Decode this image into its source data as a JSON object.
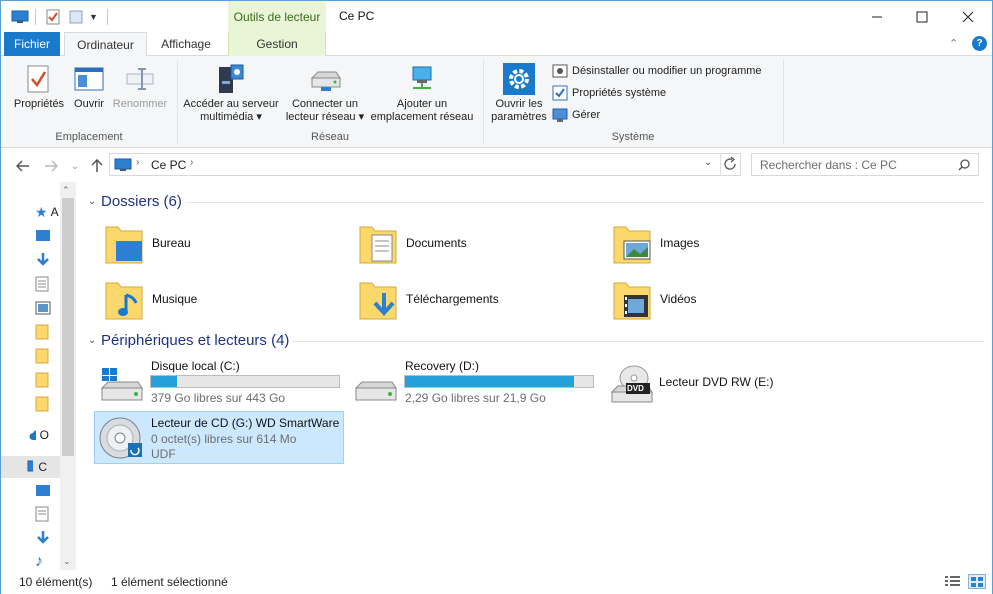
{
  "window": {
    "title": "Ce PC",
    "context_tab_header": "Outils de lecteur",
    "minimize": "—",
    "maximize": "☐",
    "close": "✕"
  },
  "tabs": {
    "file": "Fichier",
    "computer": "Ordinateur",
    "view": "Affichage",
    "manage": "Gestion"
  },
  "ribbon": {
    "location": {
      "label": "Emplacement",
      "properties": "Propriétés",
      "open": "Ouvrir",
      "rename": "Renommer"
    },
    "network": {
      "label": "Réseau",
      "media_l1": "Accéder au serveur",
      "media_l2": "multimédia",
      "map_l1": "Connecter un",
      "map_l2": "lecteur réseau",
      "add_l1": "Ajouter un",
      "add_l2": "emplacement réseau"
    },
    "system": {
      "label": "Système",
      "settings_l1": "Ouvrir les",
      "settings_l2": "paramètres",
      "uninstall": "Désinstaller ou modifier un programme",
      "sysprops": "Propriétés système",
      "manage": "Gérer"
    }
  },
  "address": {
    "location": "Ce PC",
    "search_placeholder": "Rechercher dans : Ce PC"
  },
  "sidebar": {
    "quick_access_partial": "A",
    "onedrive_partial": "O",
    "thispc_partial": "C"
  },
  "folders": {
    "header": "Dossiers (6)",
    "items": [
      {
        "name": "Bureau",
        "icon": "desktop-folder-icon"
      },
      {
        "name": "Documents",
        "icon": "documents-folder-icon"
      },
      {
        "name": "Images",
        "icon": "pictures-folder-icon"
      },
      {
        "name": "Musique",
        "icon": "music-folder-icon"
      },
      {
        "name": "Téléchargements",
        "icon": "downloads-folder-icon"
      },
      {
        "name": "Vidéos",
        "icon": "videos-folder-icon"
      }
    ]
  },
  "devices": {
    "header": "Périphériques et lecteurs (4)",
    "items": [
      {
        "name": "Disque local (C:)",
        "free": "379 Go libres sur 443 Go",
        "used_fraction": 0.14
      },
      {
        "name": "Recovery (D:)",
        "free": "2,29 Go libres sur 21,9 Go",
        "used_fraction": 0.9
      },
      {
        "name": "Lecteur DVD RW (E:)",
        "badge": "DVD"
      },
      {
        "name": "Lecteur de CD (G:) WD SmartWare",
        "free": "0 octet(s) libres sur 614 Mo",
        "fs": "UDF"
      }
    ]
  },
  "status": {
    "count": "10 élément(s)",
    "selected": "1 élément sélectionné"
  },
  "colors": {
    "accent": "#1979ca",
    "drive_bar": "#26a0da",
    "selection": "#cce8ff",
    "context_tab": "#e9f5d7",
    "section_header": "#1e3287"
  }
}
